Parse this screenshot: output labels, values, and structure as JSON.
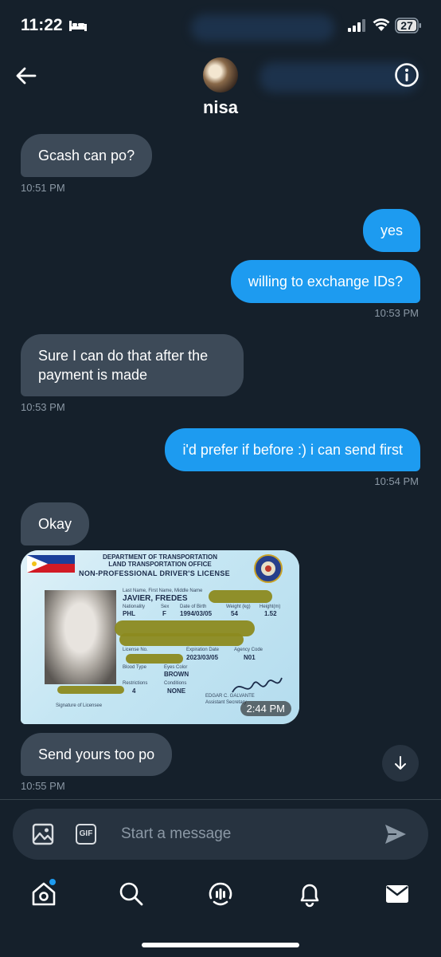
{
  "status_bar": {
    "time": "11:22",
    "battery": "27",
    "icons": [
      "bed-icon",
      "signal-icon",
      "wifi-icon",
      "battery-icon"
    ]
  },
  "header": {
    "contact_name": "nisa",
    "icons": [
      "back-arrow-icon",
      "avatar",
      "info-icon"
    ]
  },
  "messages": [
    {
      "side": "in",
      "text": "Gcash can po?",
      "time": "10:51 PM"
    },
    {
      "side": "out",
      "text": "yes"
    },
    {
      "side": "out",
      "text": "willing to exchange IDs?",
      "time": "10:53 PM"
    },
    {
      "side": "in",
      "text": "Sure I can do that after the payment is made",
      "time": "10:53 PM"
    },
    {
      "side": "out",
      "text": "i'd prefer if before :) i can send first",
      "time": "10:54 PM"
    },
    {
      "side": "in",
      "text": "Okay"
    },
    {
      "side": "in",
      "type": "image",
      "time": "2:44 PM"
    },
    {
      "side": "in",
      "text": "Send yours too po",
      "time": "10:55 PM"
    }
  ],
  "id_card": {
    "dept": "DEPARTMENT OF TRANSPORTATION",
    "office": "LAND TRANSPORTATION OFFICE",
    "title": "NON-PROFESSIONAL DRIVER'S LICENSE",
    "name_label": "Last Name, First Name, Middle Name",
    "name": "JAVIER, FREDES",
    "nationality_label": "Nationality",
    "nationality": "PHL",
    "sex_label": "Sex",
    "sex": "F",
    "dob_label": "Date of Birth",
    "dob": "1994/03/05",
    "weight_label": "Weight (kg)",
    "weight": "54",
    "height_label": "Height(m)",
    "height": "1.52",
    "expiry_label": "Expiration Date",
    "expiry": "2023/03/05",
    "agency_label": "Agency Code",
    "agency": "N01",
    "eyes_label": "Eyes Color",
    "eyes": "BROWN",
    "blood_label": "Blood Type",
    "conditions_label": "Conditions",
    "conditions": "NONE",
    "restrictions_label": "Restrictions",
    "restrictions": "4",
    "license_label": "License No.",
    "signature_label": "Signature of Licensee",
    "official": "EDGAR C. GALVANTE",
    "official_title": "Assistant Secretary"
  },
  "composer": {
    "placeholder": "Start a message",
    "gif_label": "GIF",
    "icons": [
      "image-icon",
      "gif-icon",
      "send-icon"
    ]
  },
  "tab_bar": {
    "icons": [
      "home-icon",
      "search-icon",
      "spaces-icon",
      "notifications-icon",
      "messages-icon"
    ]
  },
  "colors": {
    "background": "#15202b",
    "incoming_bubble": "#3d4a58",
    "outgoing_bubble": "#1d9bf0",
    "timestamp": "#8b98a5"
  }
}
